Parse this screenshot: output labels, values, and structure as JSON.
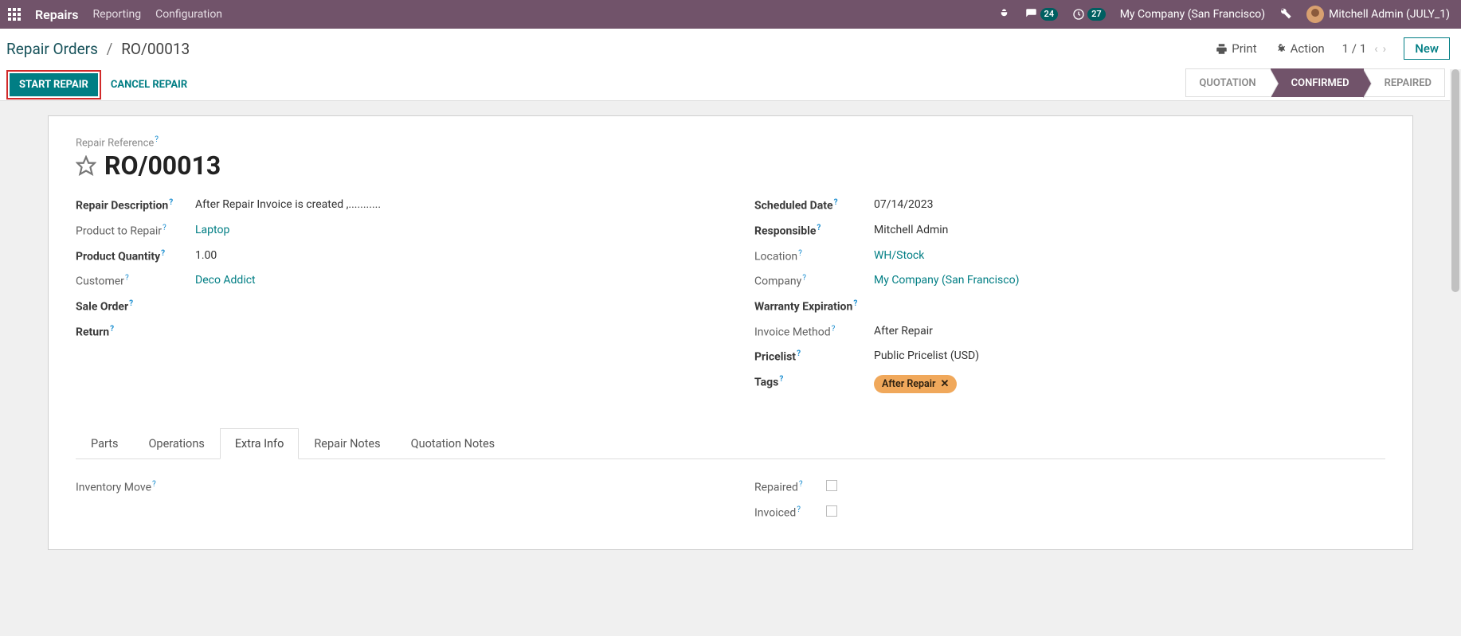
{
  "topbar": {
    "app": "Repairs",
    "menus": [
      "Reporting",
      "Configuration"
    ],
    "chat_count": "24",
    "activity_count": "27",
    "company": "My Company (San Francisco)",
    "user": "Mitchell Admin (JULY_1)"
  },
  "breadcrumb": {
    "parent": "Repair Orders",
    "current": "RO/00013"
  },
  "controls": {
    "print": "Print",
    "action": "Action",
    "pager": "1 / 1",
    "new_btn": "New",
    "start_repair": "START REPAIR",
    "cancel_repair": "CANCEL REPAIR"
  },
  "status": [
    "QUOTATION",
    "CONFIRMED",
    "REPAIRED"
  ],
  "form": {
    "ref_label": "Repair Reference",
    "ref": "RO/00013",
    "left": {
      "desc_l": "Repair Description",
      "desc_v": "After Repair Invoice is created ,...........",
      "prod_l": "Product to Repair",
      "prod_v": "Laptop",
      "qty_l": "Product Quantity",
      "qty_v": "1.00",
      "cust_l": "Customer",
      "cust_v": "Deco Addict",
      "so_l": "Sale Order",
      "ret_l": "Return"
    },
    "right": {
      "sched_l": "Scheduled Date",
      "sched_v": "07/14/2023",
      "resp_l": "Responsible",
      "resp_v": "Mitchell Admin",
      "loc_l": "Location",
      "loc_v": "WH/Stock",
      "comp_l": "Company",
      "comp_v": "My Company (San Francisco)",
      "warr_l": "Warranty Expiration",
      "inv_l": "Invoice Method",
      "inv_v": "After Repair",
      "price_l": "Pricelist",
      "price_v": "Public Pricelist (USD)",
      "tags_l": "Tags",
      "tags_v": "After Repair"
    }
  },
  "tabs": [
    "Parts",
    "Operations",
    "Extra Info",
    "Repair Notes",
    "Quotation Notes"
  ],
  "extra": {
    "invmove_l": "Inventory Move",
    "repaired_l": "Repaired",
    "invoiced_l": "Invoiced"
  }
}
